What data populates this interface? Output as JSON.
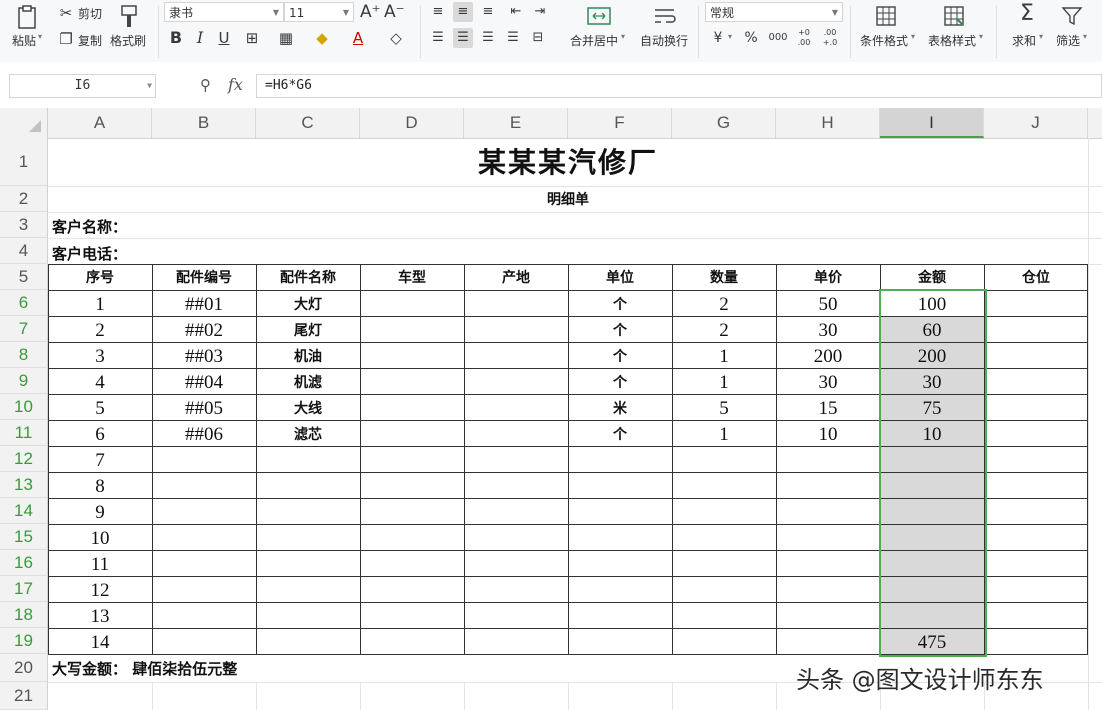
{
  "ribbon": {
    "paste": "粘贴",
    "cut": "剪切",
    "copy": "复制",
    "format_painter": "格式刷",
    "font_name": "隶书",
    "font_size": "11",
    "bold": "B",
    "italic": "I",
    "underline": "U",
    "merge_center": "合并居中",
    "wrap_text": "自动换行",
    "number_format": "常规",
    "currency": "¥",
    "percent": "%",
    "thousands": "000",
    "inc_decimal": "+0 .00",
    "dec_decimal": ".00 +.0",
    "conditional_format": "条件格式",
    "table_style": "表格样式",
    "sum": "求和",
    "filter": "筛选"
  },
  "formula_bar": {
    "name_box": "I6",
    "fx": "fx",
    "formula": "=H6*G6"
  },
  "columns": [
    "A",
    "B",
    "C",
    "D",
    "E",
    "F",
    "G",
    "H",
    "I",
    "J"
  ],
  "selected_column": "I",
  "rows": [
    "1",
    "2",
    "3",
    "4",
    "5",
    "6",
    "7",
    "8",
    "9",
    "10",
    "11",
    "12",
    "13",
    "14",
    "15",
    "16",
    "17",
    "18",
    "19",
    "20",
    "21"
  ],
  "sheet": {
    "title": "某某某汽修厂",
    "subtitle": "明细单",
    "customer_name": "客户名称：",
    "customer_phone": "客户电话：",
    "headers": [
      "序号",
      "配件编号",
      "配件名称",
      "车型",
      "产地",
      "单位",
      "数量",
      "单价",
      "金额",
      "仓位"
    ],
    "items": [
      {
        "no": "1",
        "code": "##01",
        "name": "大灯",
        "unit": "个",
        "qty": "2",
        "price": "50",
        "amount": "100"
      },
      {
        "no": "2",
        "code": "##02",
        "name": "尾灯",
        "unit": "个",
        "qty": "2",
        "price": "30",
        "amount": "60"
      },
      {
        "no": "3",
        "code": "##03",
        "name": "机油",
        "unit": "个",
        "qty": "1",
        "price": "200",
        "amount": "200"
      },
      {
        "no": "4",
        "code": "##04",
        "name": "机滤",
        "unit": "个",
        "qty": "1",
        "price": "30",
        "amount": "30"
      },
      {
        "no": "5",
        "code": "##05",
        "name": "大线",
        "unit": "米",
        "qty": "5",
        "price": "15",
        "amount": "75"
      },
      {
        "no": "6",
        "code": "##06",
        "name": "滤芯",
        "unit": "个",
        "qty": "1",
        "price": "10",
        "amount": "10"
      }
    ],
    "empty_numbers": [
      "7",
      "8",
      "9",
      "10",
      "11",
      "12",
      "13"
    ],
    "last_number": "14",
    "total": "475",
    "amount_in_words": "大写金额： 肆佰柒拾伍元整"
  },
  "watermark": "头条 @图文设计师东东"
}
